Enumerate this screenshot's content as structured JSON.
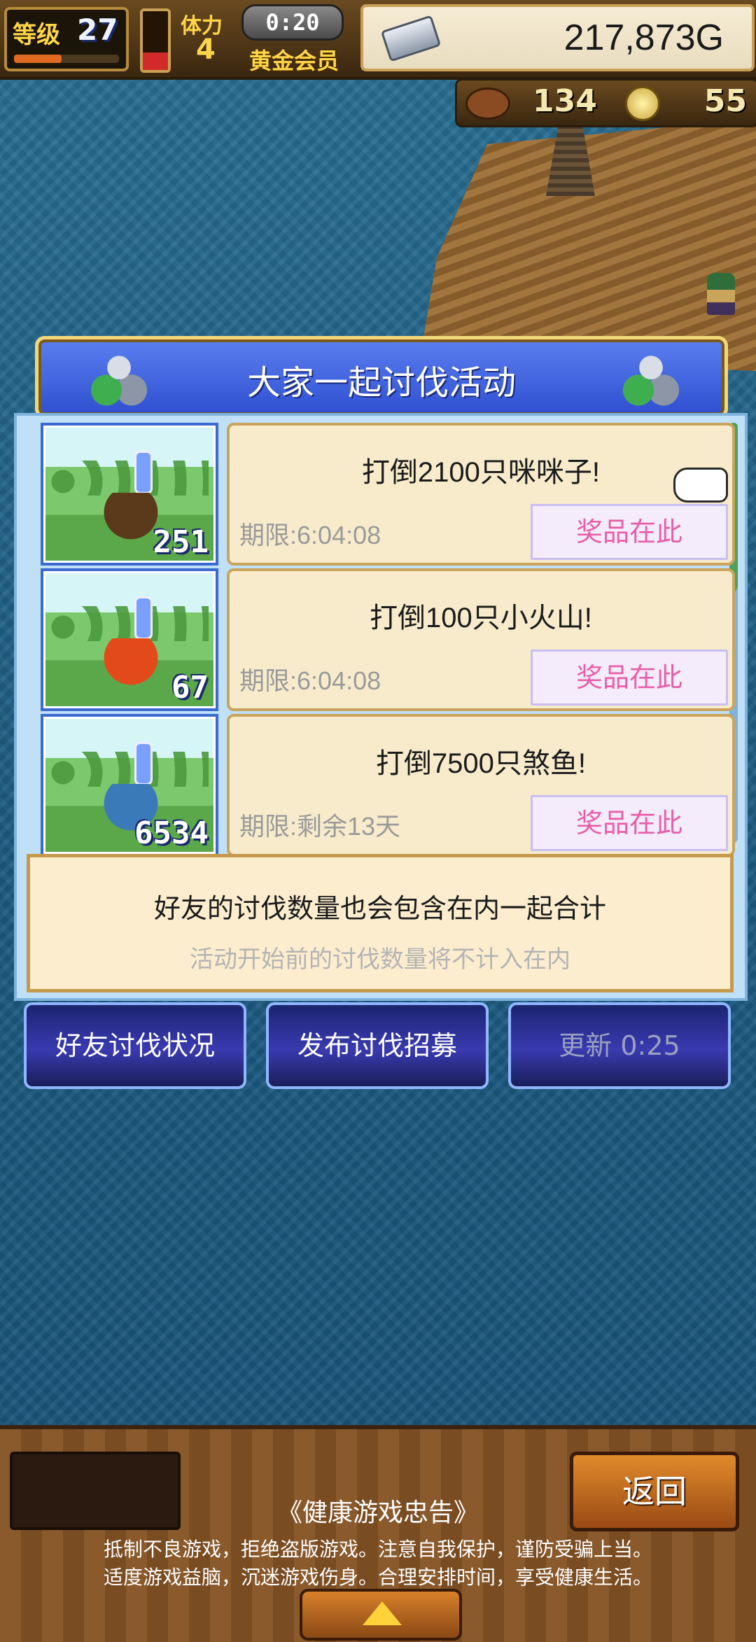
{
  "hud": {
    "level_label": "等级",
    "level": "27",
    "level_progress": 0.45,
    "stamina_fill": 0.3,
    "stamina_label": "体力",
    "stamina_value": "4",
    "timer": "0:20",
    "membership": "黄金会员",
    "gold": "217,873G",
    "meat_count": "134",
    "coin_count": "55"
  },
  "panel": {
    "title": "大家一起讨伐活动"
  },
  "events": [
    {
      "title": "打倒2100只咪咪子!",
      "deadline": "期限:6:04:08",
      "prize_label": "奖品在此",
      "count": "251",
      "monster": "mimic-chest",
      "monster_color": "#5a3a1a"
    },
    {
      "title": "打倒100只小火山!",
      "deadline": "期限:6:04:08",
      "prize_label": "奖品在此",
      "count": "67",
      "monster": "fire-spirit",
      "monster_color": "#e24a1a"
    },
    {
      "title": "打倒7500只煞鱼!",
      "deadline": "期限:剩余13天",
      "prize_label": "奖品在此",
      "count": "6534",
      "monster": "shark",
      "monster_color": "#3a7ab8"
    }
  ],
  "notice": {
    "main": "好友的讨伐数量也会包含在内一起合计",
    "sub": "活动开始前的讨伐数量将不计入在内"
  },
  "buttons": {
    "friends_status": "好友讨伐状况",
    "recruit": "发布讨伐招募",
    "refresh": "更新 0:25"
  },
  "footer": {
    "back": "返回",
    "health_title": "《健康游戏忠告》",
    "health_line1": "抵制不良游戏，拒绝盗版游戏。注意自我保护，谨防受骗上当。",
    "health_line2": "适度游戏益脑，沉迷游戏伤身。合理安排时间，享受健康生活。"
  },
  "colors": {
    "prize_text": "#e85ea8",
    "panel_header": "#2f4fd0",
    "gold_text": "#ffd64a"
  }
}
